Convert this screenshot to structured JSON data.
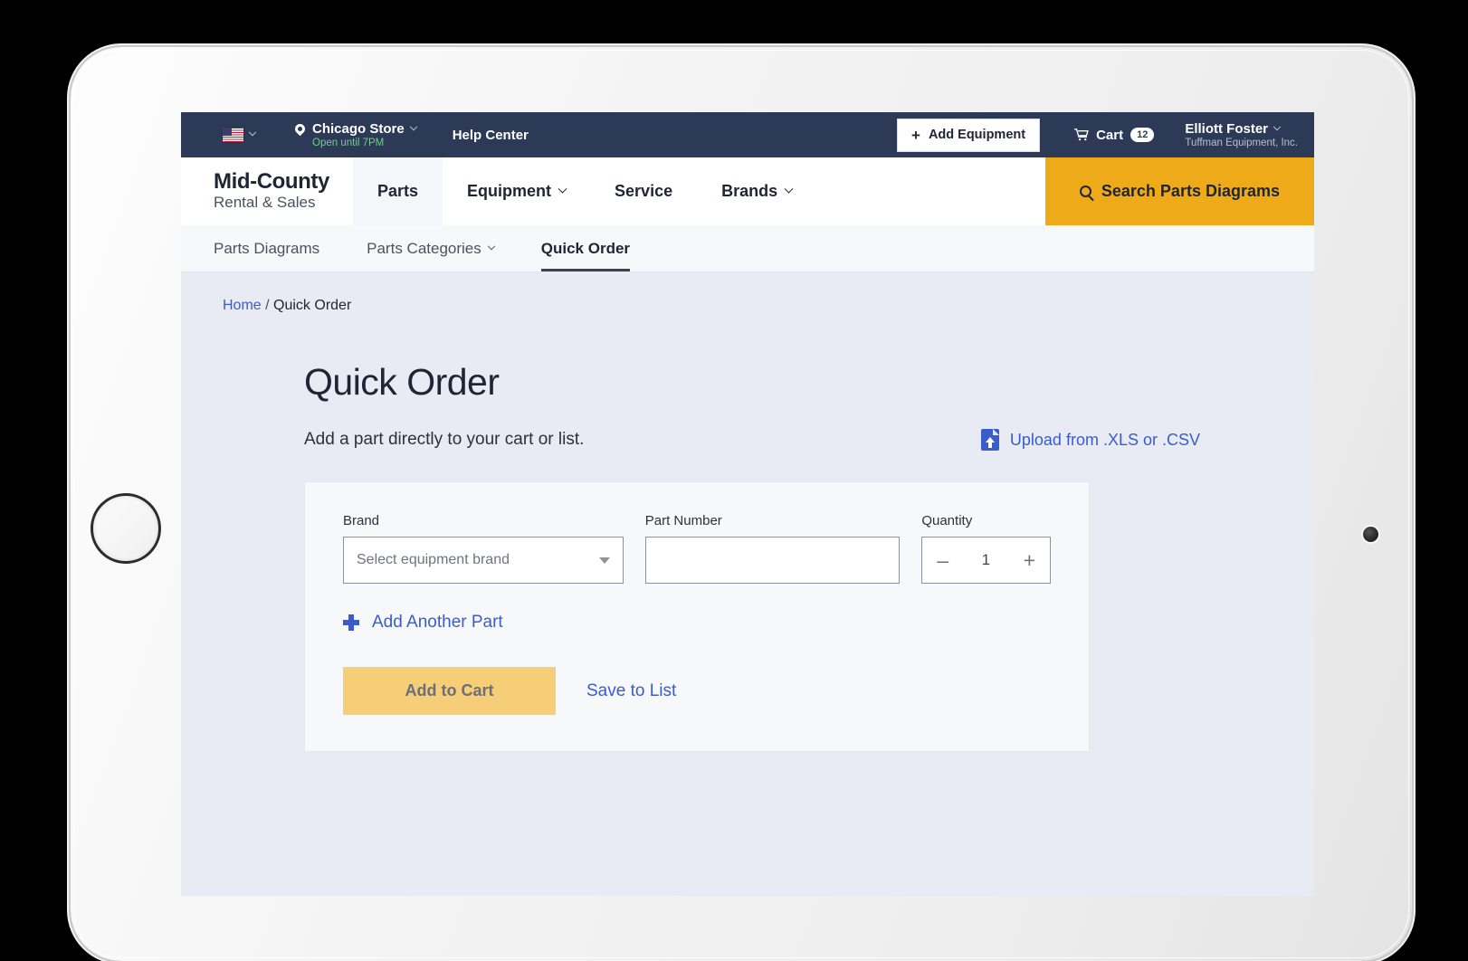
{
  "utility_bar": {
    "flag_icon": "us-flag-icon",
    "store_name": "Chicago Store",
    "store_hours": "Open until 7PM",
    "help_center": "Help Center",
    "add_equipment": "Add Equipment",
    "cart_label": "Cart",
    "cart_count": "12",
    "account_name": "Elliott Foster",
    "account_company": "Tuffman Equipment, Inc."
  },
  "main_nav": {
    "logo_title": "Mid-County",
    "logo_sub": "Rental & Sales",
    "items": [
      {
        "label": "Parts",
        "has_chevron": false,
        "active": true
      },
      {
        "label": "Equipment",
        "has_chevron": true,
        "active": false
      },
      {
        "label": "Service",
        "has_chevron": false,
        "active": false
      },
      {
        "label": "Brands",
        "has_chevron": true,
        "active": false
      }
    ],
    "search_label": "Search Parts Diagrams"
  },
  "sub_nav": {
    "items": [
      {
        "label": "Parts Diagrams",
        "has_chevron": false,
        "active": false
      },
      {
        "label": "Parts Categories",
        "has_chevron": true,
        "active": false
      },
      {
        "label": "Quick Order",
        "has_chevron": false,
        "active": true
      }
    ]
  },
  "breadcrumb": {
    "home": "Home",
    "separator": "/",
    "current": "Quick Order"
  },
  "page": {
    "title": "Quick Order",
    "subtitle": "Add a part directly to your cart or list.",
    "upload_link": "Upload from .XLS or .CSV"
  },
  "form": {
    "brand_label": "Brand",
    "brand_placeholder": "Select equipment brand",
    "part_label": "Part Number",
    "part_value": "",
    "part_placeholder": "",
    "quantity_label": "Quantity",
    "quantity_value": "1",
    "decrement": "–",
    "increment": "+",
    "add_another": "Add Another Part",
    "add_to_cart": "Add to Cart",
    "save_to_list": "Save to List"
  },
  "colors": {
    "navy": "#2c3a57",
    "amber": "#efaa1a",
    "amber_muted": "#f7ce78",
    "link_blue": "#3b5ccc",
    "page_bg": "#e8ebf3",
    "green": "#6fcf8b"
  }
}
